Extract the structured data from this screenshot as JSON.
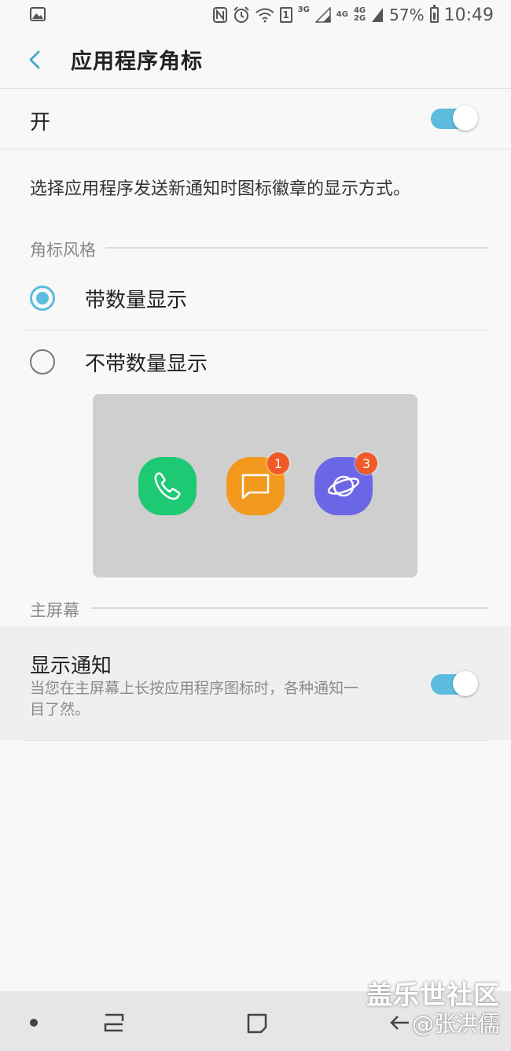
{
  "status_bar": {
    "network_3g": "3G",
    "network_4g": "4G",
    "network_4g2": "4G",
    "network_2g": "2G",
    "sim_number": "1",
    "battery": "57%",
    "time": "10:49",
    "icons": [
      "image-icon",
      "nfc-icon",
      "alarm-icon",
      "wifi-icon",
      "signal-icon",
      "battery-icon"
    ]
  },
  "header": {
    "title": "应用程序角标",
    "back_icon": "chevron-left-icon"
  },
  "master_switch": {
    "label": "开",
    "on": true
  },
  "description": "选择应用程序发送新通知时图标徽章的显示方式。",
  "badge_style": {
    "section_title": "角标风格",
    "options": [
      {
        "label": "带数量显示",
        "selected": true
      },
      {
        "label": "不带数量显示",
        "selected": false
      }
    ]
  },
  "preview": {
    "apps": [
      {
        "icon": "phone-icon",
        "color": "#1ec974",
        "badge": ""
      },
      {
        "icon": "message-icon",
        "color": "#f39a1e",
        "badge": "1"
      },
      {
        "icon": "internet-icon",
        "color": "#6b66e6",
        "badge": "3"
      }
    ],
    "badge_color": "#f05a28"
  },
  "home_screen": {
    "section_title": "主屏幕",
    "show_notifications": {
      "title": "显示通知",
      "description": "当您在主屏幕上长按应用程序图标时，各种通知一目了然。",
      "on": true
    }
  },
  "watermark": {
    "site": "盖乐世社区",
    "credit": "@张洪儒"
  },
  "colors": {
    "accent": "#5bbcdd",
    "background": "#f8f8f8"
  }
}
